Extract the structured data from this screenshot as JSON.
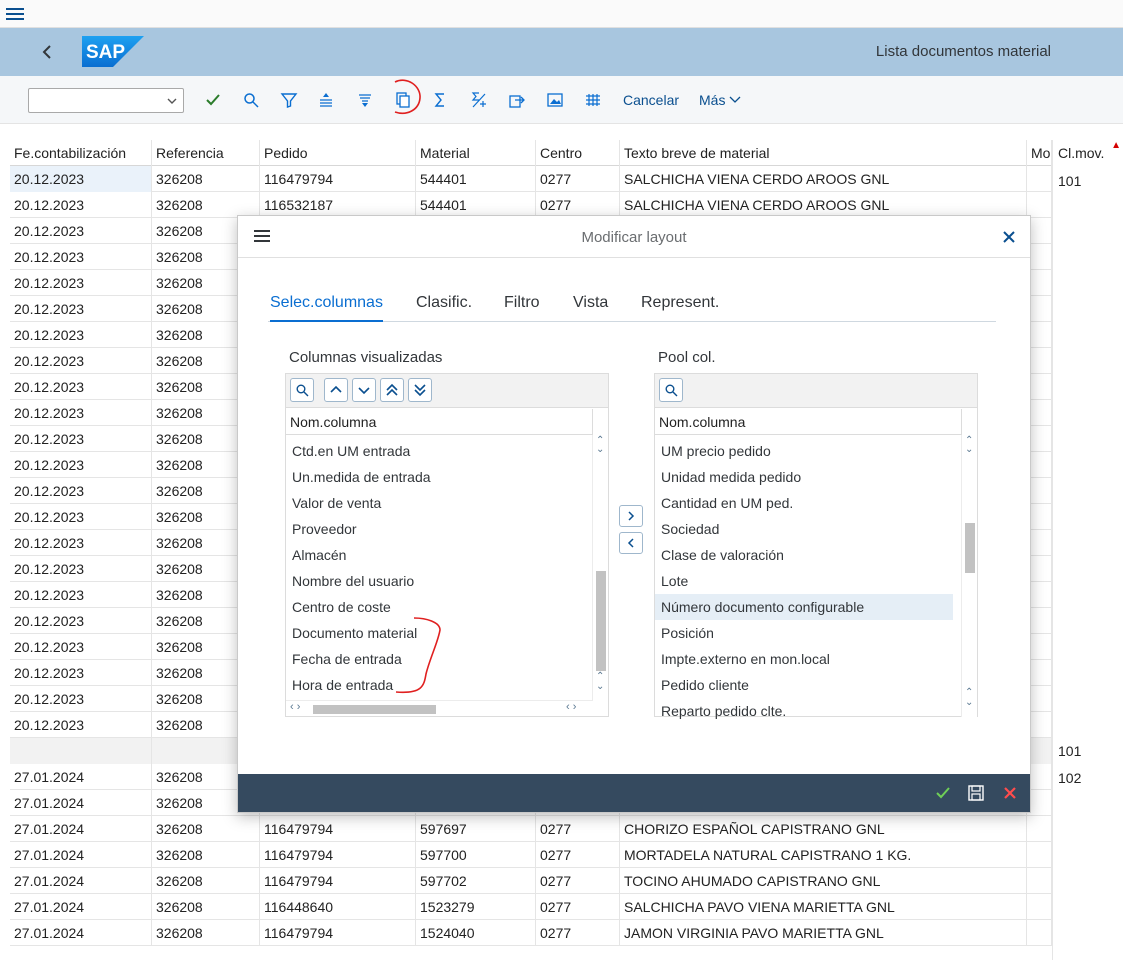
{
  "app": {
    "title": "Lista documentos material",
    "logo_text": "SAP"
  },
  "toolbar": {
    "variant_value": "",
    "cancel_label": "Cancelar",
    "more_label": "Más"
  },
  "grid": {
    "columns": [
      "Fe.contabilización",
      "Referencia",
      "Pedido",
      "Material",
      "Centro",
      "Texto breve de material",
      "Mo",
      "Cl.mov."
    ],
    "rows": [
      [
        "20.12.2023",
        "326208",
        "116479794",
        "544401",
        "0277",
        "SALCHICHA VIENA CERDO AROOS GNL"
      ],
      [
        "20.12.2023",
        "326208",
        "116532187",
        "544401",
        "0277",
        "SALCHICHA VIENA CERDO AROOS GNL"
      ],
      [
        "20.12.2023",
        "326208",
        "",
        "",
        "",
        ""
      ],
      [
        "20.12.2023",
        "326208",
        "",
        "",
        "",
        ""
      ],
      [
        "20.12.2023",
        "326208",
        "",
        "",
        "",
        ""
      ],
      [
        "20.12.2023",
        "326208",
        "",
        "",
        "",
        ""
      ],
      [
        "20.12.2023",
        "326208",
        "",
        "",
        "",
        ""
      ],
      [
        "20.12.2023",
        "326208",
        "",
        "",
        "",
        ""
      ],
      [
        "20.12.2023",
        "326208",
        "",
        "",
        "",
        ""
      ],
      [
        "20.12.2023",
        "326208",
        "",
        "",
        "",
        ""
      ],
      [
        "20.12.2023",
        "326208",
        "",
        "",
        "",
        ""
      ],
      [
        "20.12.2023",
        "326208",
        "",
        "",
        "",
        ""
      ],
      [
        "20.12.2023",
        "326208",
        "",
        "",
        "",
        ""
      ],
      [
        "20.12.2023",
        "326208",
        "",
        "",
        "",
        ""
      ],
      [
        "20.12.2023",
        "326208",
        "",
        "",
        "",
        ""
      ],
      [
        "20.12.2023",
        "326208",
        "",
        "",
        "",
        ""
      ],
      [
        "20.12.2023",
        "326208",
        "",
        "",
        "",
        ""
      ],
      [
        "20.12.2023",
        "326208",
        "",
        "",
        "",
        ""
      ],
      [
        "20.12.2023",
        "326208",
        "",
        "",
        "",
        ""
      ],
      [
        "20.12.2023",
        "326208",
        "",
        "",
        "",
        ""
      ],
      [
        "20.12.2023",
        "326208",
        "",
        "",
        "",
        ""
      ],
      [
        "20.12.2023",
        "326208",
        "",
        "",
        "",
        ""
      ],
      [
        "",
        "",
        "",
        "",
        "",
        ""
      ],
      [
        "27.01.2024",
        "326208",
        "",
        "",
        "",
        ""
      ],
      [
        "27.01.2024",
        "326208",
        "",
        "",
        "",
        ""
      ],
      [
        "27.01.2024",
        "326208",
        "116479794",
        "597697",
        "0277",
        "CHORIZO ESPAÑOL CAPISTRANO GNL"
      ],
      [
        "27.01.2024",
        "326208",
        "116479794",
        "597700",
        "0277",
        "MORTADELA NATURAL CAPISTRANO 1 KG."
      ],
      [
        "27.01.2024",
        "326208",
        "116479794",
        "597702",
        "0277",
        "TOCINO AHUMADO CAPISTRANO GNL"
      ],
      [
        "27.01.2024",
        "326208",
        "116448640",
        "1523279",
        "0277",
        "SALCHICHA PAVO VIENA MARIETTA GNL"
      ],
      [
        "27.01.2024",
        "326208",
        "116479794",
        "1524040",
        "0277",
        "JAMON VIRGINIA PAVO MARIETTA GNL"
      ]
    ],
    "clmov_values": [
      "101",
      "101",
      "102"
    ]
  },
  "dialog": {
    "title": "Modificar layout",
    "tabs": [
      "Selec.columnas",
      "Clasific.",
      "Filtro",
      "Vista",
      "Represent."
    ],
    "active_tab": "Selec.columnas",
    "left_pane": {
      "title": "Columnas visualizadas",
      "column_header": "Nom.columna",
      "items": [
        "Ctd.en UM entrada",
        "Un.medida de entrada",
        "Valor de venta",
        "Proveedor",
        "Almacén",
        "Nombre del usuario",
        "Centro de coste",
        "Documento material",
        "Fecha de entrada",
        "Hora de entrada"
      ]
    },
    "right_pane": {
      "title": "Pool col.",
      "column_header": "Nom.columna",
      "items": [
        "UM precio pedido",
        "Unidad medida pedido",
        "Cantidad en UM ped.",
        "Sociedad",
        "Clase de valoración",
        "Lote",
        "Número documento configurable",
        "Posición",
        "Impte.externo en mon.local",
        "Pedido cliente",
        "Reparto pedido clte."
      ],
      "selected_item": "Número documento configurable"
    }
  },
  "colors": {
    "titlebar": "#a8c6df",
    "accent": "#0a6ed1",
    "dialog_footer": "#354a5f",
    "annotation": "#e02020"
  }
}
